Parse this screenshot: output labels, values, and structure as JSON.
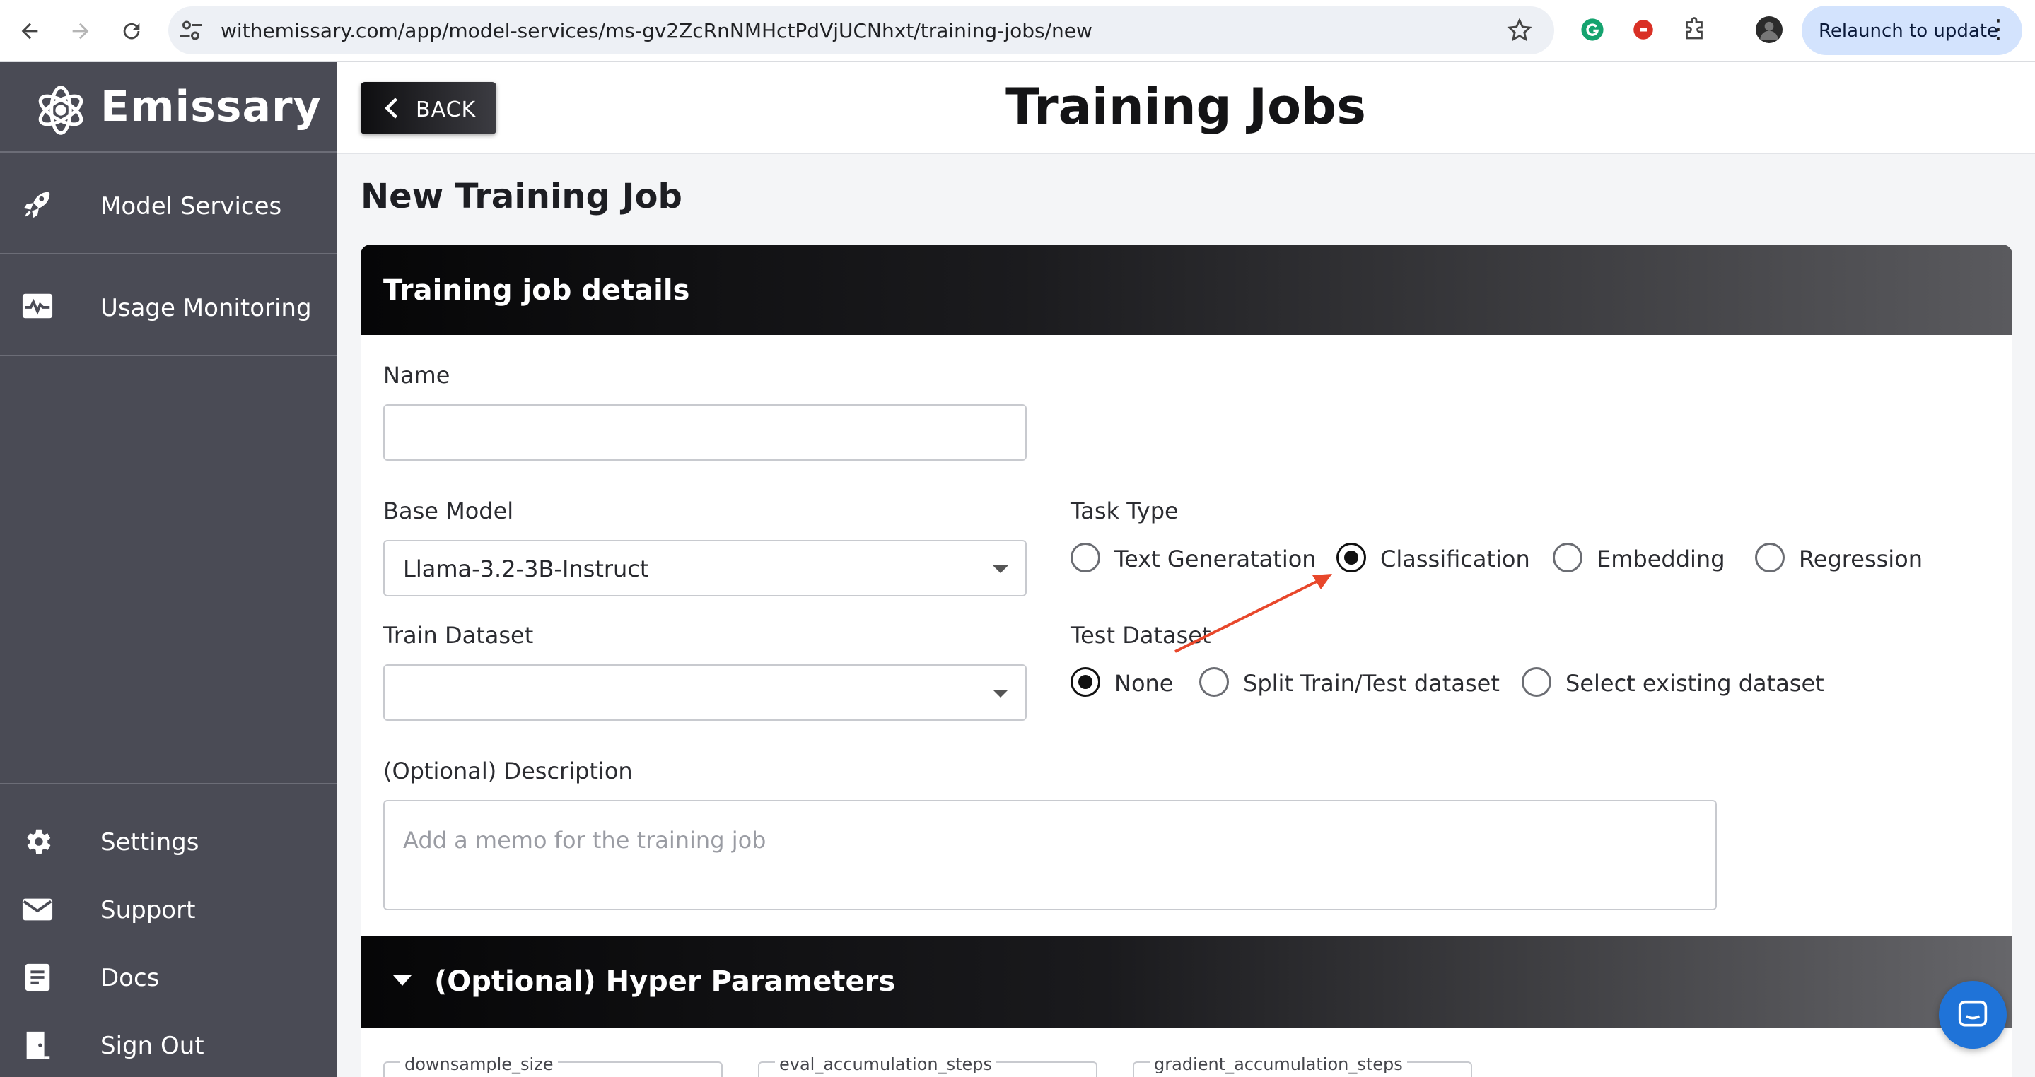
{
  "browser": {
    "url": "withemissary.com/app/model-services/ms-gv2ZcRnNMHctPdVjUCNhxt/training-jobs/new",
    "relaunch_label": "Relaunch to update"
  },
  "sidebar": {
    "brand": "Emissary",
    "items": [
      {
        "label": "Model Services",
        "icon": "rocket-icon"
      },
      {
        "label": "Usage Monitoring",
        "icon": "pulse-monitor-icon"
      }
    ],
    "bottom_links": [
      {
        "label": "Settings",
        "icon": "gear-icon"
      },
      {
        "label": "Support",
        "icon": "envelope-icon"
      },
      {
        "label": "Docs",
        "icon": "document-icon"
      },
      {
        "label": "Sign Out",
        "icon": "door-exit-icon"
      }
    ]
  },
  "header": {
    "back_label": "BACK",
    "title": "Training Jobs"
  },
  "section_title": "New Training Job",
  "card": {
    "title": "Training job details",
    "name": {
      "label": "Name",
      "value": ""
    },
    "base_model": {
      "label": "Base Model",
      "value": "Llama-3.2-3B-Instruct"
    },
    "task_type": {
      "label": "Task Type",
      "options": [
        "Text Generatation",
        "Classification",
        "Embedding",
        "Regression"
      ],
      "selected": "Classification"
    },
    "train_dataset": {
      "label": "Train Dataset",
      "value": ""
    },
    "test_dataset": {
      "label": "Test Dataset",
      "options": [
        "None",
        "Split Train/Test dataset",
        "Select existing dataset"
      ],
      "selected": "None"
    },
    "description": {
      "label": "(Optional) Description",
      "placeholder": "Add a memo for the training job"
    }
  },
  "hyper_parameters": {
    "title": "(Optional) Hyper Parameters",
    "fields": [
      "downsample_size",
      "eval_accumulation_steps",
      "gradient_accumulation_steps"
    ]
  },
  "colors": {
    "sidebar_bg": "#4a4b55",
    "annotation_arrow": "#e8472b",
    "chat_bubble": "#1f73d8"
  }
}
